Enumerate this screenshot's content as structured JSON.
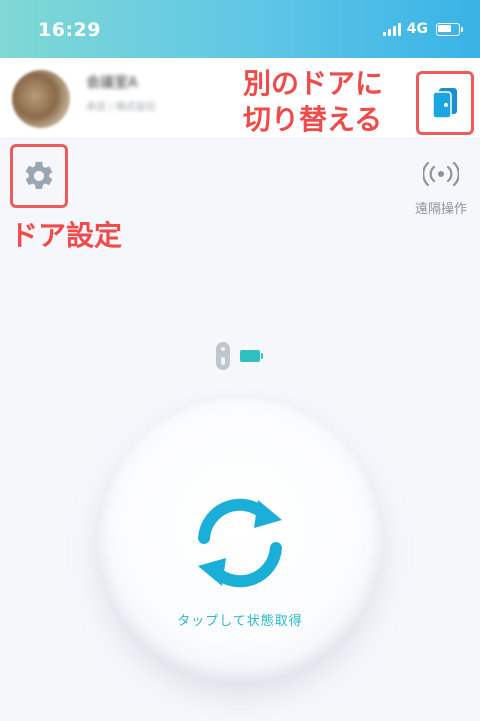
{
  "status_bar": {
    "time": "16:29",
    "network": "4G",
    "icons": [
      "signal-icon",
      "battery-icon"
    ],
    "battery_level": 0.7
  },
  "header": {
    "device_name": "会議室A",
    "device_subtitle": "本店 / 株式会社",
    "switch_door_icon": "door-icon"
  },
  "annotations": {
    "switch_door_line1": "別のドアに",
    "switch_door_line2": "切り替える",
    "door_settings": "ドア設定",
    "annotation_color": "#ef4b4b"
  },
  "toolbar": {
    "settings_icon": "gear-icon",
    "remote_icon": "broadcast-icon",
    "remote_label": "遠隔操作"
  },
  "lock_status": {
    "lock_icon": "lock-cylinder-icon",
    "battery_icon": "battery-icon",
    "battery_color": "#2fc0c4"
  },
  "main": {
    "refresh_icon": "refresh-icon",
    "action_label": "タップして状態取得",
    "accent_color": "#1aaed8"
  }
}
